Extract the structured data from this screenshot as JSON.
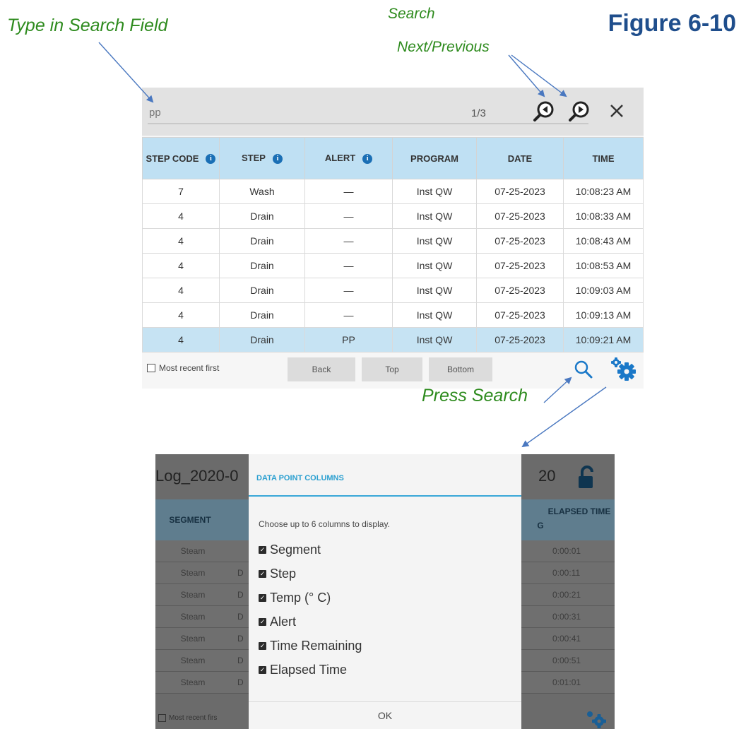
{
  "annotations": {
    "type_in_search_field": "Type in Search Field",
    "search": "Search",
    "next_previous": "Next/Previous",
    "press_search": "Press Search",
    "figure": "Figure 6-10"
  },
  "search_panel": {
    "search_value": "pp",
    "match_count": "1/3",
    "icons": [
      "search-previous-icon",
      "search-next-icon",
      "close-icon"
    ],
    "columns": [
      "STEP CODE",
      "STEP",
      "ALERT",
      "PROGRAM",
      "DATE",
      "TIME"
    ],
    "rows": [
      [
        "7",
        "Wash",
        "—",
        "Inst QW",
        "07-25-2023",
        "10:08:23 AM"
      ],
      [
        "4",
        "Drain",
        "—",
        "Inst QW",
        "07-25-2023",
        "10:08:33 AM"
      ],
      [
        "4",
        "Drain",
        "—",
        "Inst QW",
        "07-25-2023",
        "10:08:43 AM"
      ],
      [
        "4",
        "Drain",
        "—",
        "Inst QW",
        "07-25-2023",
        "10:08:53 AM"
      ],
      [
        "4",
        "Drain",
        "—",
        "Inst QW",
        "07-25-2023",
        "10:09:03 AM"
      ],
      [
        "4",
        "Drain",
        "—",
        "Inst QW",
        "07-25-2023",
        "10:09:13 AM"
      ],
      [
        "4",
        "Drain",
        "PP",
        "Inst QW",
        "07-25-2023",
        "10:09:21 AM"
      ]
    ],
    "selected_row": 6,
    "most_recent_label": "Most recent first",
    "back_label": "Back",
    "top_label": "Top",
    "bottom_label": "Bottom"
  },
  "background_screen": {
    "title_left": "Log_2020-0",
    "title_right": "20",
    "col_segment": "SEGMENT",
    "col_elapsed": "ELAPSED TIME",
    "col_partial": "G",
    "rows": [
      [
        "Steam",
        "",
        "0:00:01"
      ],
      [
        "Steam",
        "D",
        "0:00:11"
      ],
      [
        "Steam",
        "D",
        "0:00:21"
      ],
      [
        "Steam",
        "D",
        "0:00:31"
      ],
      [
        "Steam",
        "D",
        "0:00:41"
      ],
      [
        "Steam",
        "D",
        "0:00:51"
      ],
      [
        "Steam",
        "D",
        "0:01:01"
      ]
    ],
    "most_recent_label": "Most recent firs"
  },
  "dialog": {
    "title": "DATA POINT COLUMNS",
    "instruction": "Choose up to 6 columns to display.",
    "options": [
      {
        "label": "Segment",
        "checked": true
      },
      {
        "label": "Step",
        "checked": true
      },
      {
        "label": "Temp (° C)",
        "checked": true
      },
      {
        "label": "Alert",
        "checked": true
      },
      {
        "label": "Time Remaining",
        "checked": true
      },
      {
        "label": "Elapsed Time",
        "checked": true
      }
    ],
    "ok_label": "OK"
  },
  "colors": {
    "annotation_green": "#2e8b1e",
    "figure_blue": "#1f4e8c",
    "header_blue": "#bfe0f3",
    "selected_row": "#c6e3f3",
    "accent": "#2a9fd0"
  }
}
